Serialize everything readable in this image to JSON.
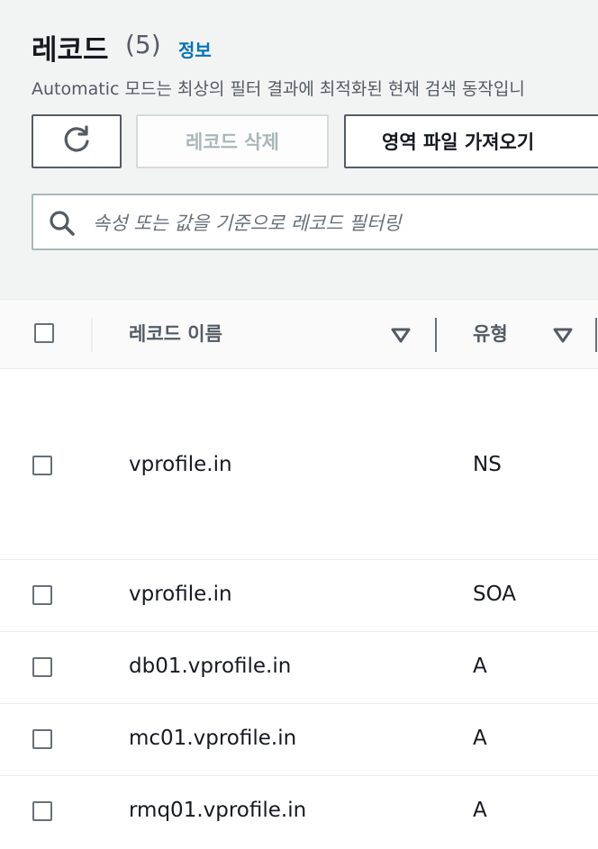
{
  "header": {
    "title": "레코드",
    "count": "(5)",
    "info_link": "정보",
    "description": "Automatic 모드는 최상의 필터 결과에 최적화된 현재 검색 동작입니"
  },
  "toolbar": {
    "refresh_icon": "refresh-icon",
    "delete_label": "레코드 삭제",
    "import_label": "영역 파일 가져오기"
  },
  "search": {
    "placeholder": "속성 또는 값을 기준으로 레코드 필터링",
    "value": ""
  },
  "table": {
    "columns": [
      "레코드 이름",
      "유형"
    ],
    "rows": [
      {
        "name": "vprofile.in",
        "type": "NS"
      },
      {
        "name": "vprofile.in",
        "type": "SOA"
      },
      {
        "name": "db01.vprofile.in",
        "type": "A"
      },
      {
        "name": "mc01.vprofile.in",
        "type": "A"
      },
      {
        "name": "rmq01.vprofile.in",
        "type": "A"
      }
    ]
  },
  "colors": {
    "accent_link": "#0073bb",
    "panel_bg": "#f2f3f3",
    "text": "#16191f"
  }
}
